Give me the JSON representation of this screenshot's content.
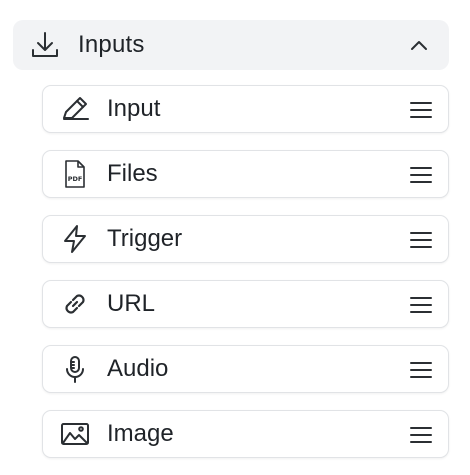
{
  "section": {
    "title": "Inputs",
    "icon": "download-icon",
    "expanded": true
  },
  "items": [
    {
      "label": "Input",
      "icon": "pencil-icon"
    },
    {
      "label": "Files",
      "icon": "pdf-file-icon",
      "icon_text": "PDF"
    },
    {
      "label": "Trigger",
      "icon": "lightning-icon"
    },
    {
      "label": "URL",
      "icon": "link-icon"
    },
    {
      "label": "Audio",
      "icon": "microphone-icon"
    },
    {
      "label": "Image",
      "icon": "image-icon"
    }
  ],
  "colors": {
    "header_bg": "#f2f3f5",
    "border": "#e1e3e6",
    "text": "#1f2328",
    "icon": "#2b2f33"
  }
}
